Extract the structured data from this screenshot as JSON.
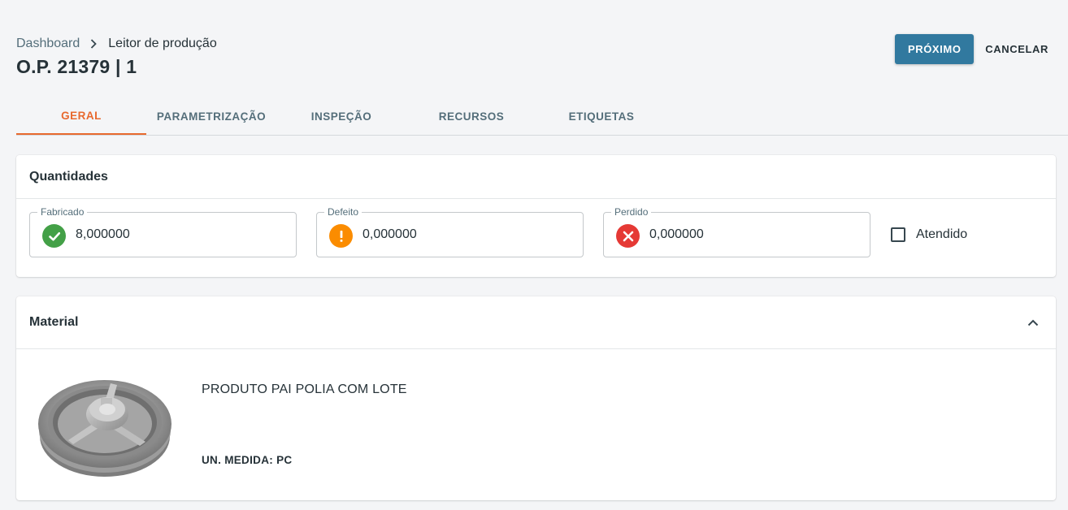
{
  "breadcrumb": {
    "root": "Dashboard",
    "current": "Leitor de produção"
  },
  "page": {
    "title": "O.P. 21379 | 1"
  },
  "actions": {
    "next_label": "PRÓXIMO",
    "cancel_label": "CANCELAR"
  },
  "tabs": [
    {
      "label": "GERAL",
      "active": true
    },
    {
      "label": "PARAMETRIZAÇÃO",
      "active": false
    },
    {
      "label": "INSPEÇÃO",
      "active": false
    },
    {
      "label": "RECURSOS",
      "active": false
    },
    {
      "label": "ETIQUETAS",
      "active": false
    }
  ],
  "quantities": {
    "title": "Quantidades",
    "fields": [
      {
        "label": "Fabricado",
        "value": "8,000000",
        "icon": "check-circle-icon",
        "color": "#43a047"
      },
      {
        "label": "Defeito",
        "value": "0,000000",
        "icon": "warning-circle-icon",
        "color": "#fb8c00"
      },
      {
        "label": "Perdido",
        "value": "0,000000",
        "icon": "cancel-circle-icon",
        "color": "#e53935"
      }
    ],
    "checkbox": {
      "label": "Atendido",
      "checked": false
    }
  },
  "material": {
    "title": "Material",
    "name": "PRODUTO PAI POLIA COM LOTE",
    "unit": "UN. MEDIDA: PC",
    "image_icon": "pulley-image"
  },
  "colors": {
    "accent": "#e8692e",
    "primary": "#31799f"
  }
}
